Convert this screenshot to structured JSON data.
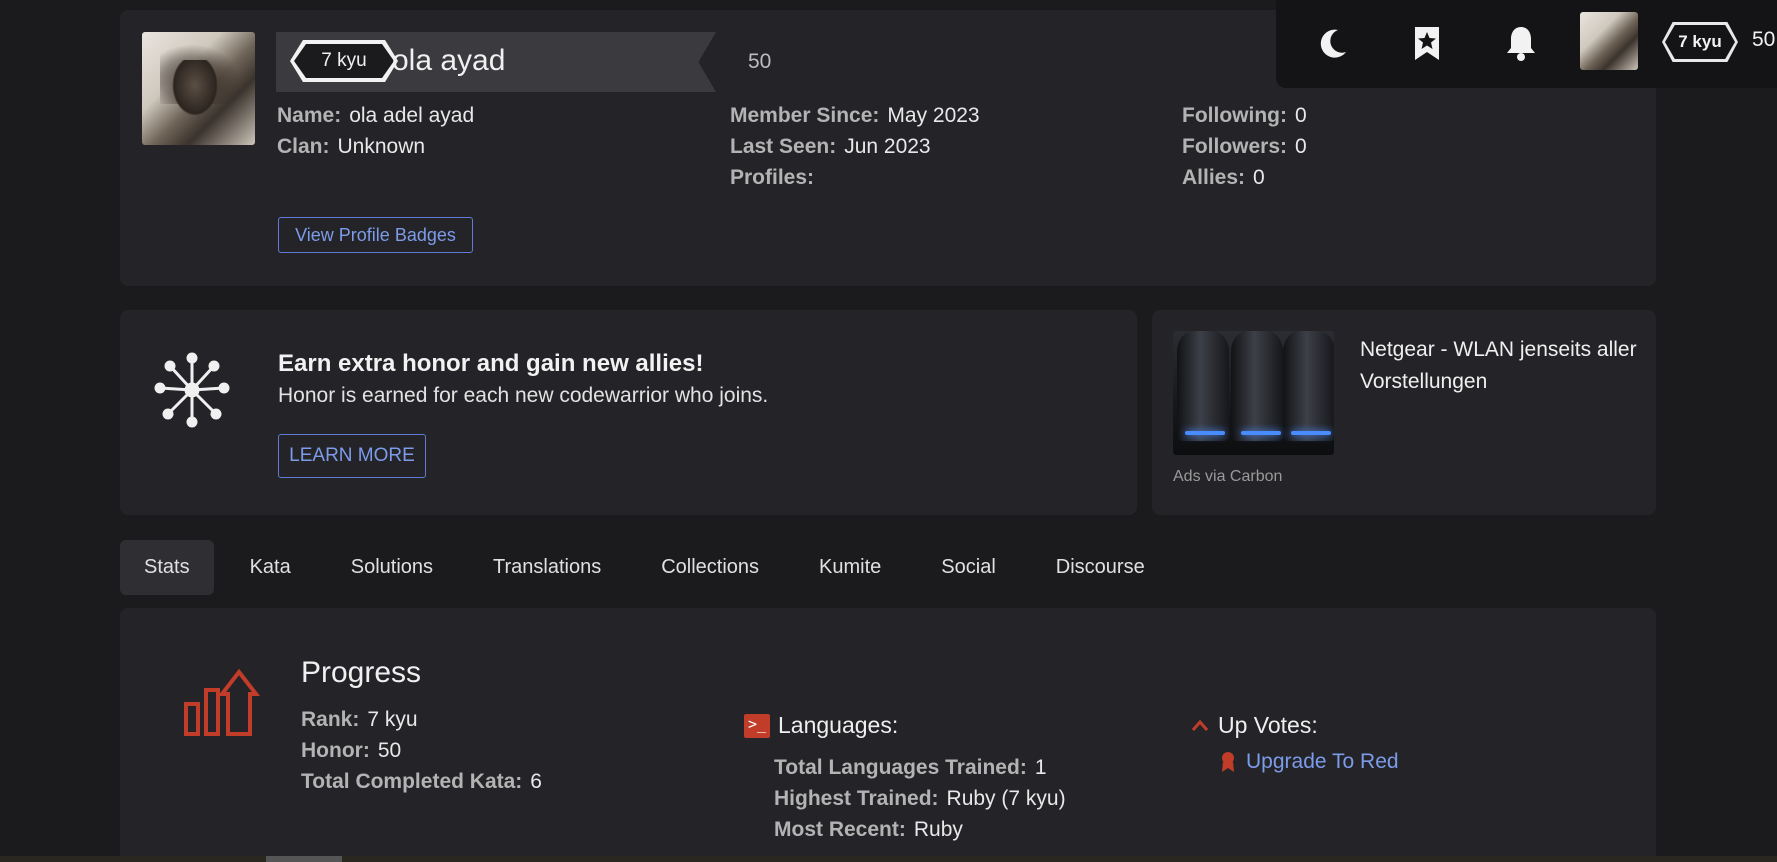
{
  "profile": {
    "rank": "7 kyu",
    "username": "ola ayad",
    "honor": "50",
    "col1": [
      {
        "label": "Name:",
        "value": "ola adel ayad"
      },
      {
        "label": "Clan:",
        "value": "Unknown"
      }
    ],
    "col2": [
      {
        "label": "Member Since:",
        "value": "May 2023"
      },
      {
        "label": "Last Seen:",
        "value": "Jun 2023"
      },
      {
        "label": "Profiles:",
        "value": ""
      }
    ],
    "col3": [
      {
        "label": "Following:",
        "value": "0"
      },
      {
        "label": "Followers:",
        "value": "0"
      },
      {
        "label": "Allies:",
        "value": "0"
      }
    ],
    "badges_button": "View Profile Badges"
  },
  "referral": {
    "title": "Earn extra honor and gain new allies!",
    "subtitle": "Honor is earned for each new codewarrior who joins.",
    "button": "LEARN MORE"
  },
  "ad": {
    "title": "Netgear - WLAN jenseits aller Vorstellungen",
    "credit": "Ads via Carbon"
  },
  "tabs": [
    "Stats",
    "Kata",
    "Solutions",
    "Translations",
    "Collections",
    "Kumite",
    "Social",
    "Discourse"
  ],
  "stats": {
    "progress_title": "Progress",
    "progress": [
      {
        "label": "Rank:",
        "value": "7 kyu"
      },
      {
        "label": "Honor:",
        "value": "50"
      },
      {
        "label": "Total Completed Kata:",
        "value": "6"
      }
    ],
    "languages_title": "Languages:",
    "languages": [
      {
        "label": "Total Languages Trained:",
        "value": "1"
      },
      {
        "label": "Highest Trained:",
        "value": "Ruby (7 kyu)"
      },
      {
        "label": "Most Recent:",
        "value": "Ruby"
      }
    ],
    "upvotes_title": "Up Votes:",
    "upgrade_link": "Upgrade To Red"
  },
  "topbar": {
    "rank": "7 kyu",
    "honor": "50"
  },
  "colors": {
    "accent_blue": "#7c9be8",
    "accent_red": "#c23c2a",
    "background": "#1b1b1e",
    "card": "#242428"
  }
}
